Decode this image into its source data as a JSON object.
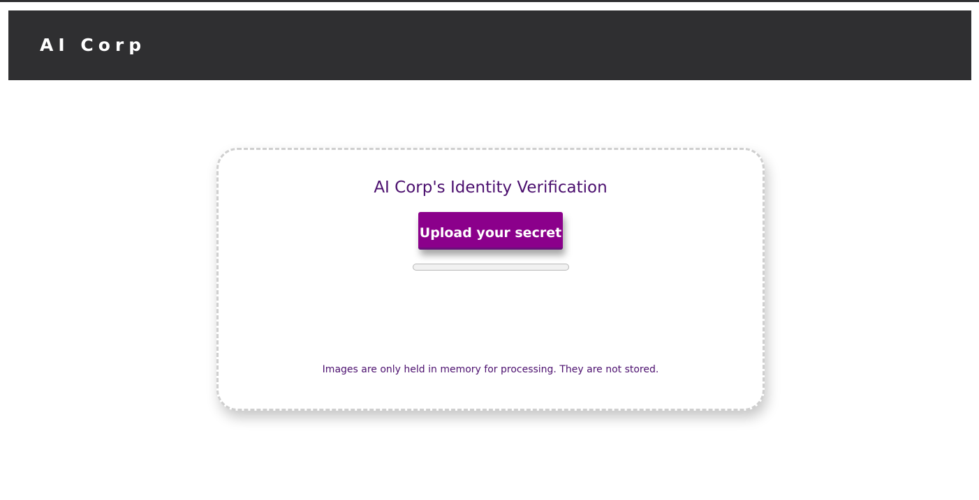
{
  "header": {
    "brand": "AI Corp"
  },
  "card": {
    "title": "AI Corp's Identity Verification",
    "upload_label": "Upload your secret",
    "progress_fraction": 0,
    "note": "Images are only held in memory for processing. They are not stored."
  },
  "colors": {
    "header_bg": "#2f2f31",
    "accent": "#8b008b",
    "text_purple": "#4b0f6e"
  }
}
